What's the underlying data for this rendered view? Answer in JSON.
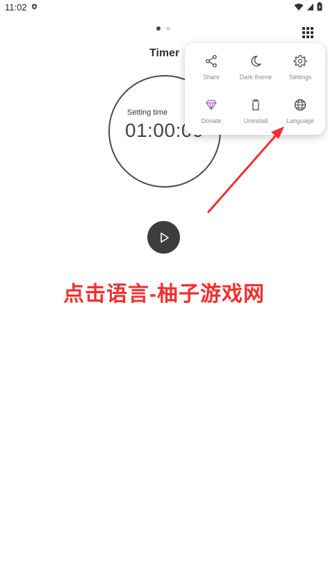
{
  "status_bar": {
    "time": "11:02"
  },
  "header": {
    "title": "Timer"
  },
  "timer": {
    "setting_label": "Setting time",
    "value": "01:00:00"
  },
  "menu": {
    "items": [
      {
        "label": "Share",
        "icon": "share-icon"
      },
      {
        "label": "Dark theme",
        "icon": "moon-icon"
      },
      {
        "label": "Settings",
        "icon": "gear-icon"
      },
      {
        "label": "Donate",
        "icon": "diamond-icon"
      },
      {
        "label": "Uninstall",
        "icon": "trash-icon"
      },
      {
        "label": "Language",
        "icon": "globe-icon"
      }
    ]
  },
  "annotation": {
    "text": "点击语言-柚子游戏网",
    "color": "#f42e2e"
  },
  "colors": {
    "play_button": "#3d3d3d",
    "donate_icon": "#9b59b6"
  }
}
